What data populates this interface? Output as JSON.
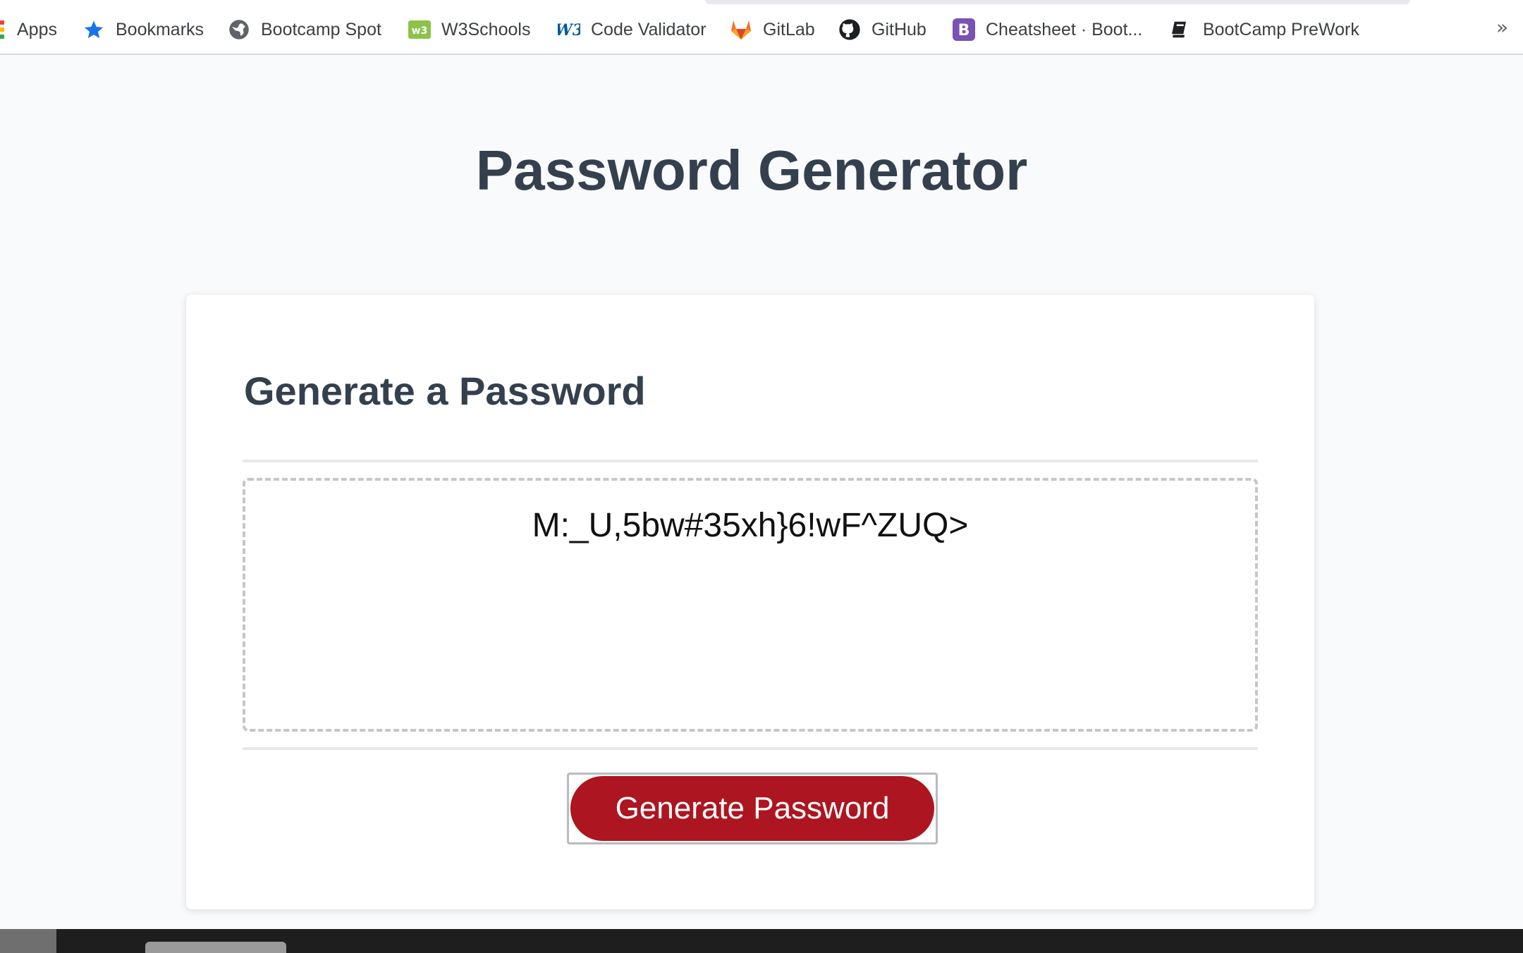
{
  "bookmarks": [
    {
      "label": "Apps",
      "icon": "apps-grid-icon"
    },
    {
      "label": "Bookmarks",
      "icon": "star-icon"
    },
    {
      "label": "Bootcamp Spot",
      "icon": "globe-icon"
    },
    {
      "label": "W3Schools",
      "icon": "w3schools-icon"
    },
    {
      "label": "Code Validator",
      "icon": "w3c-icon"
    },
    {
      "label": "GitLab",
      "icon": "gitlab-icon"
    },
    {
      "label": "GitHub",
      "icon": "github-icon"
    },
    {
      "label": "Cheatsheet · Boot...",
      "icon": "bootstrap-icon"
    },
    {
      "label": "BootCamp PreWork",
      "icon": "book-icon"
    }
  ],
  "bookmarks_overflow": "»",
  "page": {
    "title": "Password Generator",
    "card_title": "Generate a Password",
    "password": "M:_U,5bw#35xh}6!wF^ZUQ>",
    "generate_label": "Generate Password"
  },
  "colors": {
    "heading": "#34404e",
    "button": "#ad1520",
    "background": "#f9fafb"
  }
}
